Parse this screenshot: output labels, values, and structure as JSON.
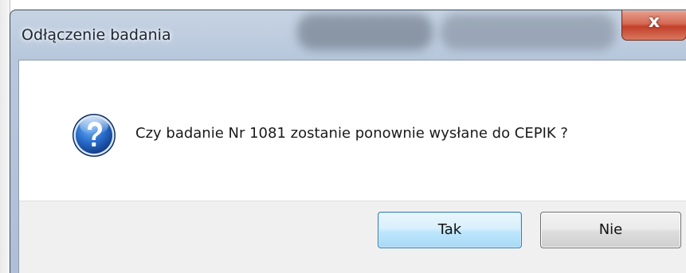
{
  "window": {
    "title": "Odłączenie badania",
    "close_glyph": "x"
  },
  "dialog": {
    "icon": "question-icon",
    "message": "Czy badanie Nr  1081 zostanie ponownie wysłane do CEPIK ?"
  },
  "buttons": {
    "yes_label": "Tak",
    "no_label": "Nie"
  },
  "colors": {
    "titlebar": "#b8c8dc",
    "close_button": "#c2402a",
    "default_button_border": "#3c7fb1",
    "question_icon": "#1f5fb8"
  }
}
